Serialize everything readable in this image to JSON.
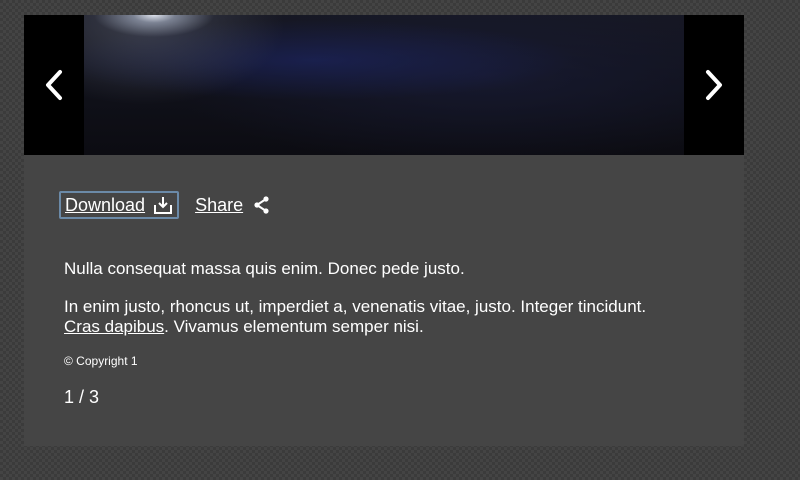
{
  "gallery": {
    "prev_icon": "chevron-left-icon",
    "next_icon": "chevron-right-icon",
    "image_description": ""
  },
  "actions": {
    "download_label": "Download",
    "download_icon": "download-icon",
    "share_label": "Share",
    "share_icon": "share-icon"
  },
  "caption": {
    "paragraph1": "Nulla consequat massa quis enim. Donec pede justo.",
    "paragraph2_part1": "In enim justo, rhoncus ut, imperdiet a, venenatis vitae, justo. Integer tincidunt.",
    "paragraph2_link": "Cras dapibus",
    "paragraph2_part2": ". Vivamus elementum semper nisi.",
    "copyright": "© Copyright 1"
  },
  "counter": {
    "text": "1 / 3"
  },
  "colors": {
    "page_background": "#3b3b3b",
    "panel_background": "#454545",
    "nav_background": "#000000",
    "focus_outline": "#6b8aa8",
    "text": "#ffffff"
  }
}
